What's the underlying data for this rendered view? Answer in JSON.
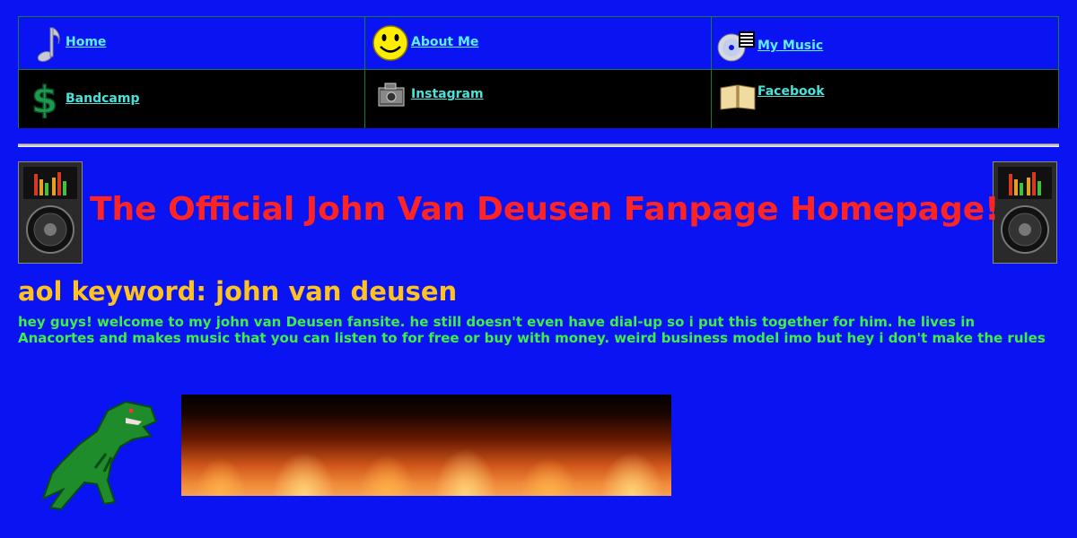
{
  "nav": {
    "row1": [
      {
        "label": "Home",
        "icon": "music-note-icon"
      },
      {
        "label": "About Me",
        "icon": "smiley-icon"
      },
      {
        "label": "My Music",
        "icon": "cd-icon"
      }
    ],
    "row2": [
      {
        "label": "Bandcamp",
        "icon": "dollar-icon"
      },
      {
        "label": "Instagram",
        "icon": "camera-icon"
      },
      {
        "label": "Facebook",
        "icon": "book-icon"
      }
    ]
  },
  "header": {
    "title": "The Official John Van Deusen Fanpage Homepage!",
    "title_color": "#ff2424"
  },
  "aol_keyword": "aol keyword: john van deusen",
  "intro": "hey guys! welcome to my john van Deusen fansite. he still doesn't even have dial-up so i put this together for him. he lives in Anacortes and makes music that you can listen to for free or buy with money. weird business model imo but hey i don't make the rules",
  "colors": {
    "background": "#0a14f2",
    "link_row1": "#5cf0ff",
    "link_row2": "#49e1d8",
    "aol": "#ffc21e",
    "intro": "#40ee48"
  },
  "images": {
    "left_speaker": "speaker-icon",
    "right_speaker": "speaker-icon",
    "dinosaur": "t-rex-image",
    "fire": "fire-banner-image"
  }
}
